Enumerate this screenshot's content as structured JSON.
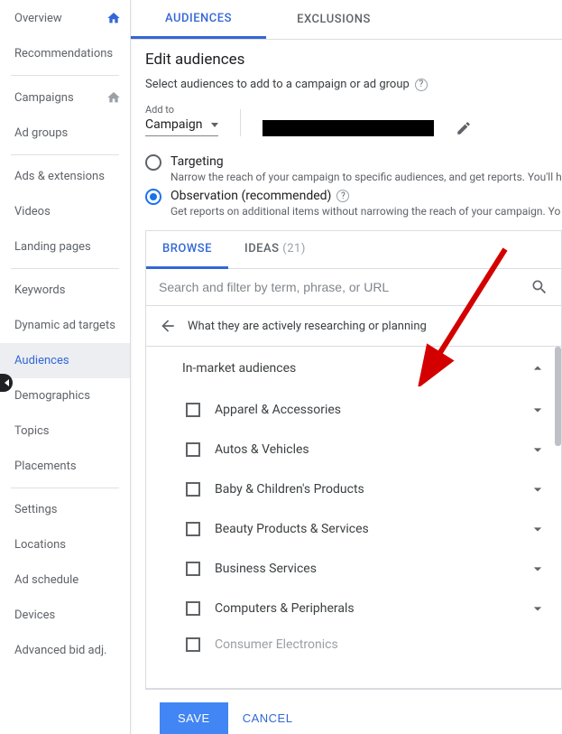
{
  "sidebar": {
    "items": [
      {
        "label": "Overview",
        "icon": "home"
      },
      {
        "label": "Recommendations"
      },
      {
        "divider": true
      },
      {
        "label": "Campaigns",
        "icon": "home-gray"
      },
      {
        "label": "Ad groups"
      },
      {
        "divider": true
      },
      {
        "label": "Ads & extensions"
      },
      {
        "label": "Videos"
      },
      {
        "label": "Landing pages"
      },
      {
        "divider": true
      },
      {
        "label": "Keywords"
      },
      {
        "label": "Dynamic ad targets"
      },
      {
        "label": "Audiences",
        "active": true
      },
      {
        "label": "Demographics"
      },
      {
        "label": "Topics"
      },
      {
        "label": "Placements"
      },
      {
        "divider": true
      },
      {
        "label": "Settings"
      },
      {
        "label": "Locations"
      },
      {
        "label": "Ad schedule"
      },
      {
        "label": "Devices"
      },
      {
        "label": "Advanced bid adj."
      }
    ]
  },
  "top_tabs": {
    "audiences": "AUDIENCES",
    "exclusions": "EXCLUSIONS"
  },
  "edit": {
    "title": "Edit audiences",
    "subtitle": "Select audiences to add to a campaign or ad group",
    "addto_label": "Add to",
    "addto_value": "Campaign"
  },
  "radios": {
    "targeting": {
      "title": "Targeting",
      "desc": "Narrow the reach of your campaign to specific audiences, and get reports. You'll h"
    },
    "observation": {
      "title": "Observation (recommended)",
      "desc": "Get reports on additional items without narrowing the reach of your campaign. Yo"
    }
  },
  "browse": {
    "tab_browse": "BROWSE",
    "tab_ideas": "IDEAS",
    "ideas_count": "(21)",
    "search_placeholder": "Search and filter by term, phrase, or URL",
    "crumb": "What they are actively researching or planning",
    "panel_head": "In-market audiences",
    "categories": [
      "Apparel & Accessories",
      "Autos & Vehicles",
      "Baby & Children's Products",
      "Beauty Products & Services",
      "Business Services",
      "Computers & Peripherals",
      "Consumer Electronics"
    ]
  },
  "footer": {
    "save": "SAVE",
    "cancel": "CANCEL"
  }
}
